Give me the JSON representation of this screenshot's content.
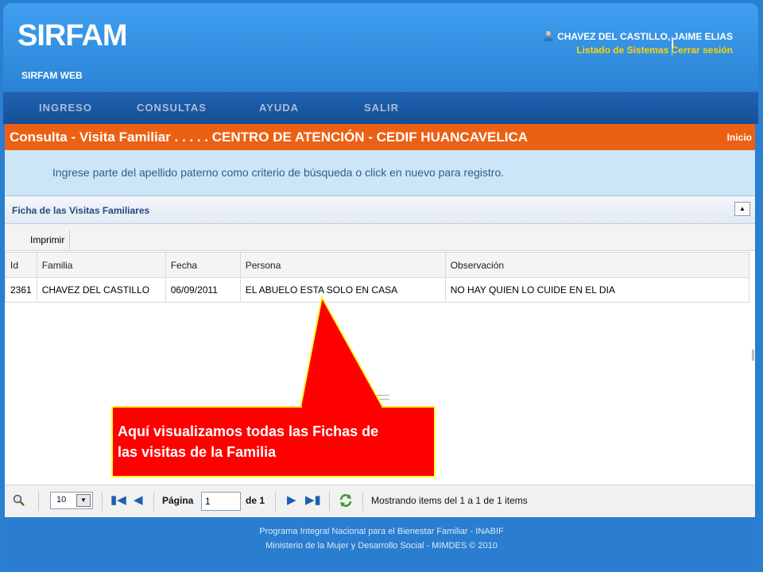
{
  "header": {
    "logo": "SIRFAM",
    "subtitle": "SIRFAM WEB",
    "user_name": "CHAVEZ DEL CASTILLO, JAIME ELIAS",
    "link_systems": "Listado de Sistemas",
    "separator": "|",
    "link_logout": "Cerrar sesión"
  },
  "nav": {
    "items": [
      "INGRESO",
      "CONSULTAS",
      "AYUDA",
      "SALIR"
    ]
  },
  "page": {
    "title": "Consulta - Visita Familiar . . . . . CENTRO DE ATENCIÓN - CEDIF HUANCAVELICA",
    "home_link": "Inicio",
    "instruction": "Ingrese parte del apellido paterno como criterio de búsqueda o click en nuevo para registro."
  },
  "panel": {
    "title": "Ficha de las Visitas Familiares",
    "print_button": "Imprimir"
  },
  "table": {
    "headers": [
      "Id",
      "Familia",
      "Fecha",
      "Persona",
      "Observación"
    ],
    "rows": [
      [
        "2361",
        "CHAVEZ DEL CASTILLO",
        "06/09/2011",
        "EL ABUELO ESTA SOLO EN CASA",
        "NO HAY QUIEN LO CUIDE EN EL DIA"
      ]
    ]
  },
  "pager": {
    "page_size": "10",
    "page_label": "Página",
    "page_value": "1",
    "of_label": "de 1",
    "status": "Mostrando items del 1 a 1 de 1 items"
  },
  "callout": {
    "line1": "Aquí visualizamos todas las Fichas de",
    "line2": "las visitas de la  Familia"
  },
  "footer": {
    "line1": "Programa Integral Nacional para el Bienestar Familiar - INABIF",
    "line2": "Ministerio de la Mujer y Desarrollo Social - MIMDES © 2010"
  },
  "colors": {
    "title_bar": "#ec6013",
    "info_band": "#cde6f7",
    "callout": "#ff0000",
    "link_yellow": "#ffd400"
  }
}
